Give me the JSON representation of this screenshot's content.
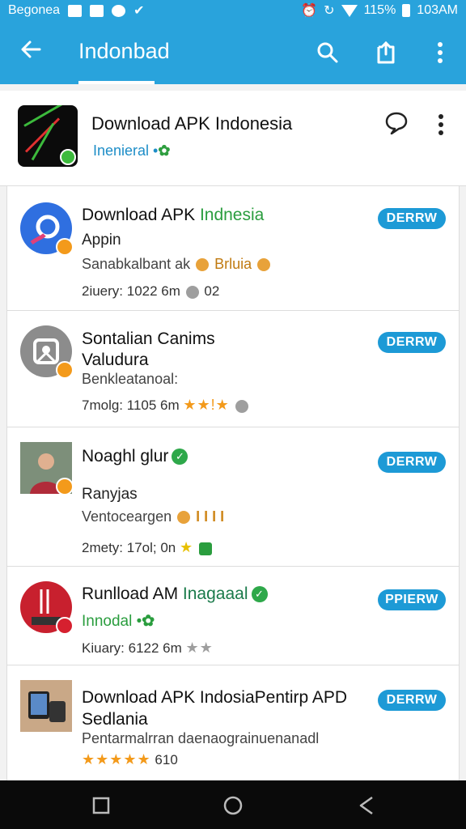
{
  "status_bar": {
    "carrier": "Begonea",
    "battery_text": "115%",
    "time": "103AM"
  },
  "app_bar": {
    "title": "Indonbad",
    "back_icon": "arrow-left-icon",
    "actions": [
      "search-icon",
      "share-icon",
      "more-vertical-icon"
    ]
  },
  "header": {
    "title": "Download APK Indonesia",
    "subtitle": "Inenieral •",
    "actions": [
      "chat-bubble-icon",
      "more-vertical-icon"
    ]
  },
  "list": [
    {
      "title": "Download APK",
      "title_accent": "Indnesia",
      "line2": "Appin",
      "line3": "Sanabkalbant ak",
      "line3_tail": "Brluia",
      "meta": "2iuery: 1022  6m",
      "meta_tail": "02",
      "action": "DERRW",
      "avatar_color": "#2f6fe0",
      "avatar_icon": "app-circle-icon"
    },
    {
      "title": "Sontalian Canims",
      "title2": "Valudura",
      "line3": "Benkleatanoal:",
      "meta": "7molg: 1105 6m",
      "stars": "★★!★",
      "action": "DERRW",
      "avatar_color": "#8c8c8c",
      "avatar_icon": "image-frame-icon"
    },
    {
      "title": "Noaghl glur",
      "line2": "Ranyjas",
      "line3": "Ventoceargen",
      "line3_tail": "I I I I",
      "meta": "2mety: 17ol; 0n",
      "action": "DERRW",
      "avatar_color": "#6b4a3a",
      "avatar_icon": "person-photo-icon"
    },
    {
      "title": "Runlload AM",
      "title_accent": "Inagaaal",
      "line2": "Innodal •",
      "meta": "Kiuary: 6122 6m",
      "stars": "★★",
      "action": "PPIERW",
      "avatar_color": "#c8202e",
      "avatar_icon": "utensils-icon"
    },
    {
      "title": "Download APK IndosiaPentirp APD",
      "title2": "Sedlania",
      "line3": "Pentarmalrran daenaograinuenanadl",
      "stars": "★★★★★",
      "rating_count": "610",
      "action": "DERRW",
      "avatar_color": "#7a5a3c",
      "avatar_icon": "devices-photo-icon"
    }
  ],
  "nav_bar": [
    "recents-square-icon",
    "home-circle-icon",
    "back-triangle-icon"
  ]
}
